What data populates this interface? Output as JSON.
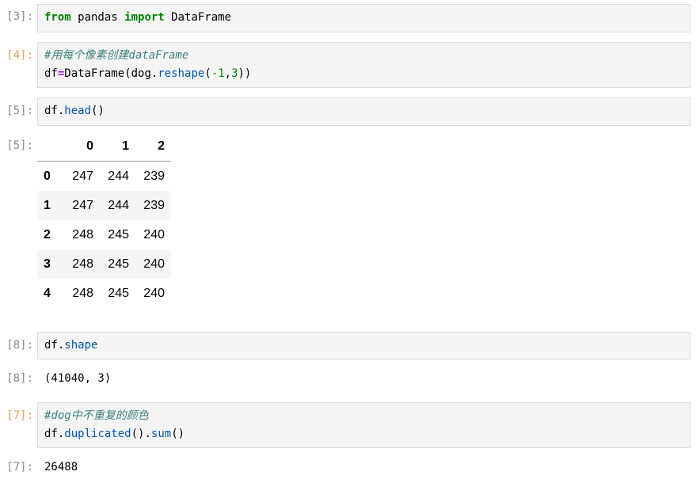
{
  "cells": [
    {
      "prompt": "[3]:",
      "code": [
        [
          {
            "t": "from",
            "c": "kw"
          },
          {
            "t": " pandas ",
            "c": ""
          },
          {
            "t": "import",
            "c": "kw"
          },
          {
            "t": " DataFrame",
            "c": ""
          }
        ]
      ]
    },
    {
      "prompt": "[4]:",
      "code": [
        [
          {
            "t": "#用每个像素创建dataFrame",
            "c": "cm"
          }
        ],
        [
          {
            "t": "df",
            "c": ""
          },
          {
            "t": "=",
            "c": "op"
          },
          {
            "t": "DataFrame(dog.",
            "c": ""
          },
          {
            "t": "reshape",
            "c": "fn"
          },
          {
            "t": "(",
            "c": ""
          },
          {
            "t": "-1",
            "c": "num"
          },
          {
            "t": ",",
            "c": ""
          },
          {
            "t": "3",
            "c": "num"
          },
          {
            "t": "))",
            "c": ""
          }
        ]
      ]
    },
    {
      "prompt": "[5]:",
      "code": [
        [
          {
            "t": "df.",
            "c": ""
          },
          {
            "t": "head",
            "c": "fn"
          },
          {
            "t": "()",
            "c": ""
          }
        ]
      ]
    },
    {
      "prompt": "[8]:",
      "code": [
        [
          {
            "t": "df.",
            "c": ""
          },
          {
            "t": "shape",
            "c": "fn"
          }
        ]
      ]
    },
    {
      "prompt": "[7]:",
      "code": [
        [
          {
            "t": "#dog中不重复的颜色",
            "c": "cm"
          }
        ],
        [
          {
            "t": "df.",
            "c": ""
          },
          {
            "t": "duplicated",
            "c": "fn"
          },
          {
            "t": "().",
            "c": ""
          },
          {
            "t": "sum",
            "c": "fn"
          },
          {
            "t": "()",
            "c": ""
          }
        ]
      ]
    }
  ],
  "outputs": {
    "head_prompt": "[5]:",
    "head_table": {
      "columns": [
        "0",
        "1",
        "2"
      ],
      "rows": [
        {
          "index": "0",
          "values": [
            "247",
            "244",
            "239"
          ]
        },
        {
          "index": "1",
          "values": [
            "247",
            "244",
            "239"
          ]
        },
        {
          "index": "2",
          "values": [
            "248",
            "245",
            "240"
          ]
        },
        {
          "index": "3",
          "values": [
            "248",
            "245",
            "240"
          ]
        },
        {
          "index": "4",
          "values": [
            "248",
            "245",
            "240"
          ]
        }
      ]
    },
    "shape_prompt": "[8]:",
    "shape_value": "(41040, 3)",
    "dup_prompt": "[7]:",
    "dup_value": "26488"
  },
  "colors": {
    "keyword": "#008000",
    "function": "#0055aa",
    "comment": "#408080",
    "prompt": "#8a8a8a",
    "prompt_active": "#e0a050"
  }
}
